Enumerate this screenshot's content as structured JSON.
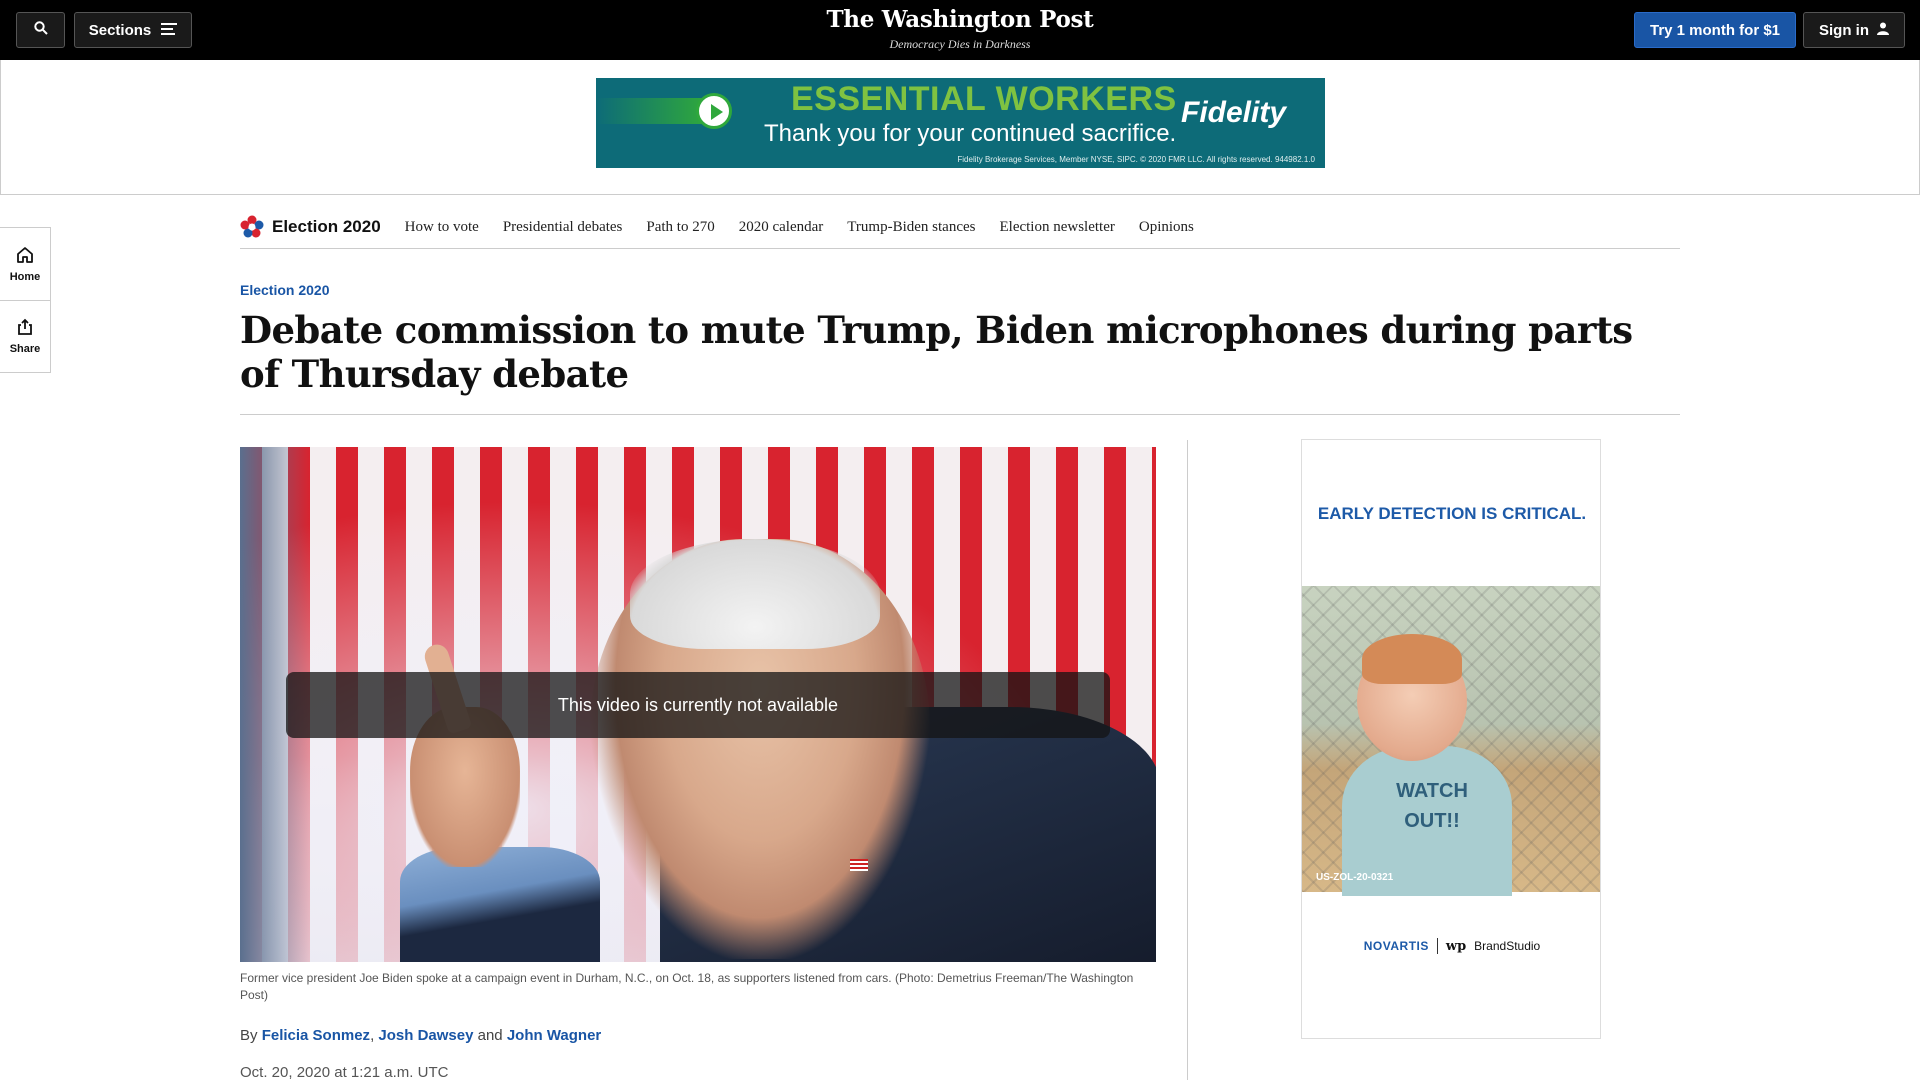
{
  "header": {
    "sections_label": "Sections",
    "logo": "The Washington Post",
    "tagline": "Democracy Dies in Darkness",
    "try_label": "Try 1 month for $1",
    "signin_label": "Sign in"
  },
  "top_ad": {
    "headline": "ESSENTIAL WORKERS",
    "subline": "Thank you for your continued sacrifice.",
    "brand": "Fidelity",
    "fineprint": "Fidelity Brokerage Services, Member NYSE, SIPC. © 2020 FMR LLC. All rights reserved. 944982.1.0"
  },
  "left_rail": {
    "home_label": "Home",
    "share_label": "Share"
  },
  "election_nav": {
    "brand": "Election 2020",
    "items": [
      {
        "label": "How to vote"
      },
      {
        "label": "Presidential debates"
      },
      {
        "label": "Path to 270"
      },
      {
        "label": "2020 calendar"
      },
      {
        "label": "Trump-Biden stances"
      },
      {
        "label": "Election newsletter"
      },
      {
        "label": "Opinions"
      }
    ]
  },
  "article": {
    "kicker": "Election 2020",
    "headline": "Debate commission to mute Trump, Biden microphones during parts of Thursday debate",
    "video_message": "This video is currently not available",
    "caption": "Former vice president Joe Biden spoke at a campaign event in Durham, N.C., on Oct. 18, as supporters listened from cars. (Photo: Demetrius Freeman/The Washington Post)",
    "by_prefix": "By",
    "authors": [
      "Felicia Sonmez",
      "Josh Dawsey",
      "John Wagner"
    ],
    "author_sep": ",",
    "and_word": "and",
    "date": "Oct. 20, 2020 at 1:21 a.m. UTC"
  },
  "side_ad": {
    "title": "EARLY DETECTION IS CRITICAL.",
    "shirt_text": "WATCH OUT!!",
    "code": "US-ZOL-20-0321",
    "sponsor_1": "NOVARTIS",
    "sponsor_2": "BrandStudio"
  },
  "colors": {
    "accent_blue": "#1955a5",
    "topbar_bg": "#000000",
    "ad_teal": "#0d6b78",
    "ad_green": "#7fc241"
  }
}
